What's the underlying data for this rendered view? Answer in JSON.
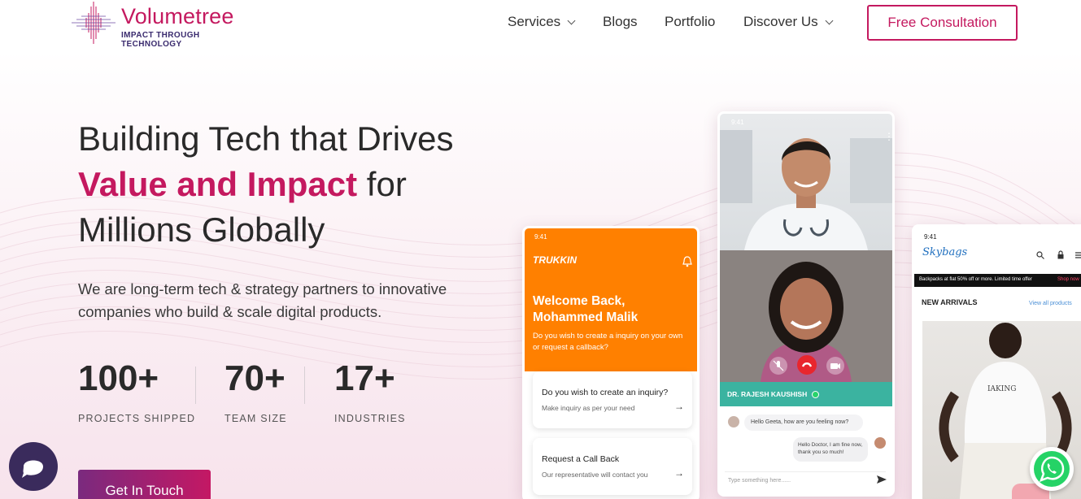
{
  "brand": {
    "name": "Volumetree",
    "tagline": "IMPACT THROUGH TECHNOLOGY"
  },
  "nav": {
    "items": [
      {
        "label": "Services"
      },
      {
        "label": "Blogs"
      },
      {
        "label": "Portfolio"
      },
      {
        "label": "Discover Us"
      }
    ],
    "cta": "Free Consultation"
  },
  "hero": {
    "line1": "Building Tech that Drives",
    "accent": "Value and Impact",
    "line2_rest": " for",
    "line3": "Millions Globally",
    "description": "We are long-term tech & strategy partners to innovative companies who build & scale digital products.",
    "cta": "Get In Touch"
  },
  "stats": [
    {
      "value": "100+",
      "label": "PROJECTS SHIPPED"
    },
    {
      "value": "70+",
      "label": "TEAM SIZE"
    },
    {
      "value": "17+",
      "label": "INDUSTRIES"
    }
  ],
  "phone_trukkin": {
    "time": "9:41",
    "brand": "TRUKKIN",
    "welcome": "Welcome Back,",
    "user": "Mohammed Malik",
    "prompt": "Do you wish to create a inquiry on your own or request a callback?",
    "cards": [
      {
        "title": "Do you wish to create an inquiry?",
        "subtitle": "Make inquiry as per your need",
        "arrow": "→"
      },
      {
        "title": "Request a Call Back",
        "subtitle": "Our representative will contact you",
        "arrow": "→"
      }
    ]
  },
  "phone_video": {
    "time": "9:41",
    "doctor_name": "DR. RAJESH KAUSHISH",
    "messages": [
      "Hello Geeta, how are you feeling now?",
      "Hello Doctor, I am fine now, thank you so much!"
    ],
    "input_placeholder": "Type something here......"
  },
  "phone_shop": {
    "time": "9:41",
    "brand": "Skybags",
    "banner": "Backpacks at flat 50% off or more. Limited time offer",
    "banner_link": "Shop now",
    "section": "NEW ARRIVALS",
    "view_all": "View all products"
  },
  "colors": {
    "accent": "#c4195f",
    "orange": "#ff8000",
    "teal": "#3bb3a0",
    "dark": "#2a2a2a"
  },
  "icons": [
    "chevron-down-icon",
    "bell-icon",
    "mic-off-icon",
    "phone-end-icon",
    "video-off-icon",
    "send-icon",
    "search-icon",
    "lock-icon",
    "menu-icon",
    "chat-widget-icon",
    "whatsapp-icon"
  ]
}
